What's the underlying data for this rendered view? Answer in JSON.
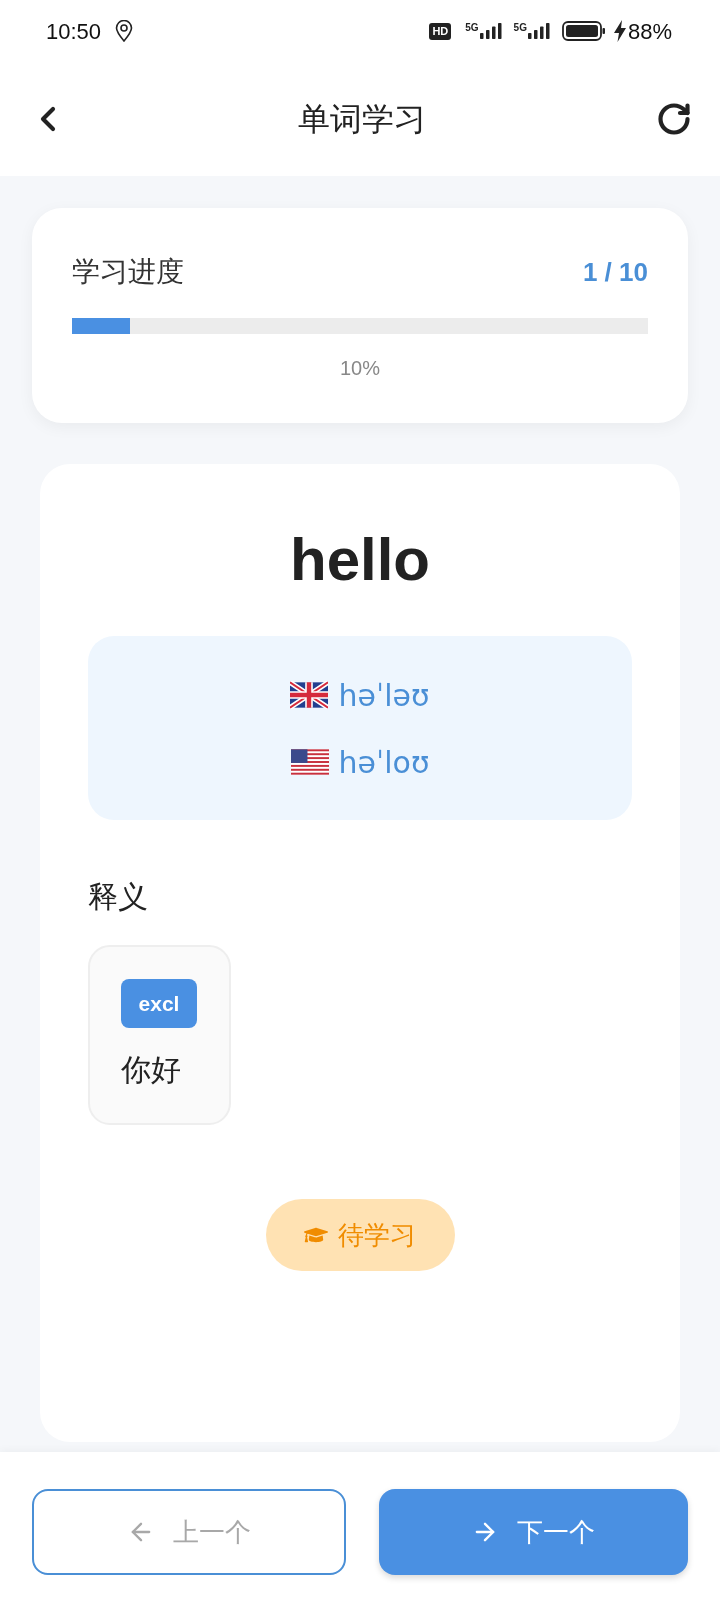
{
  "status_bar": {
    "time": "10:50",
    "hd": "HD",
    "networks": [
      "5G",
      "5G"
    ],
    "battery": "88%"
  },
  "header": {
    "title": "单词学习"
  },
  "progress": {
    "label": "学习进度",
    "count": "1 / 10",
    "level": 0.1,
    "percent": "10%"
  },
  "word": {
    "text": "hello",
    "phonetics": [
      {
        "kind": "uk",
        "text": "həˈləʊ"
      },
      {
        "kind": "us",
        "text": "həˈloʊ"
      }
    ],
    "definitions_title": "释义",
    "definitions": [
      {
        "pos": "excl",
        "meaning": "你好"
      }
    ],
    "status": {
      "kind": "pending",
      "label": "待学习"
    }
  },
  "buttons": [
    {
      "kind": "prev",
      "label": "上一个",
      "disabled": true
    },
    {
      "kind": "next",
      "label": "下一个",
      "disabled": false
    }
  ]
}
